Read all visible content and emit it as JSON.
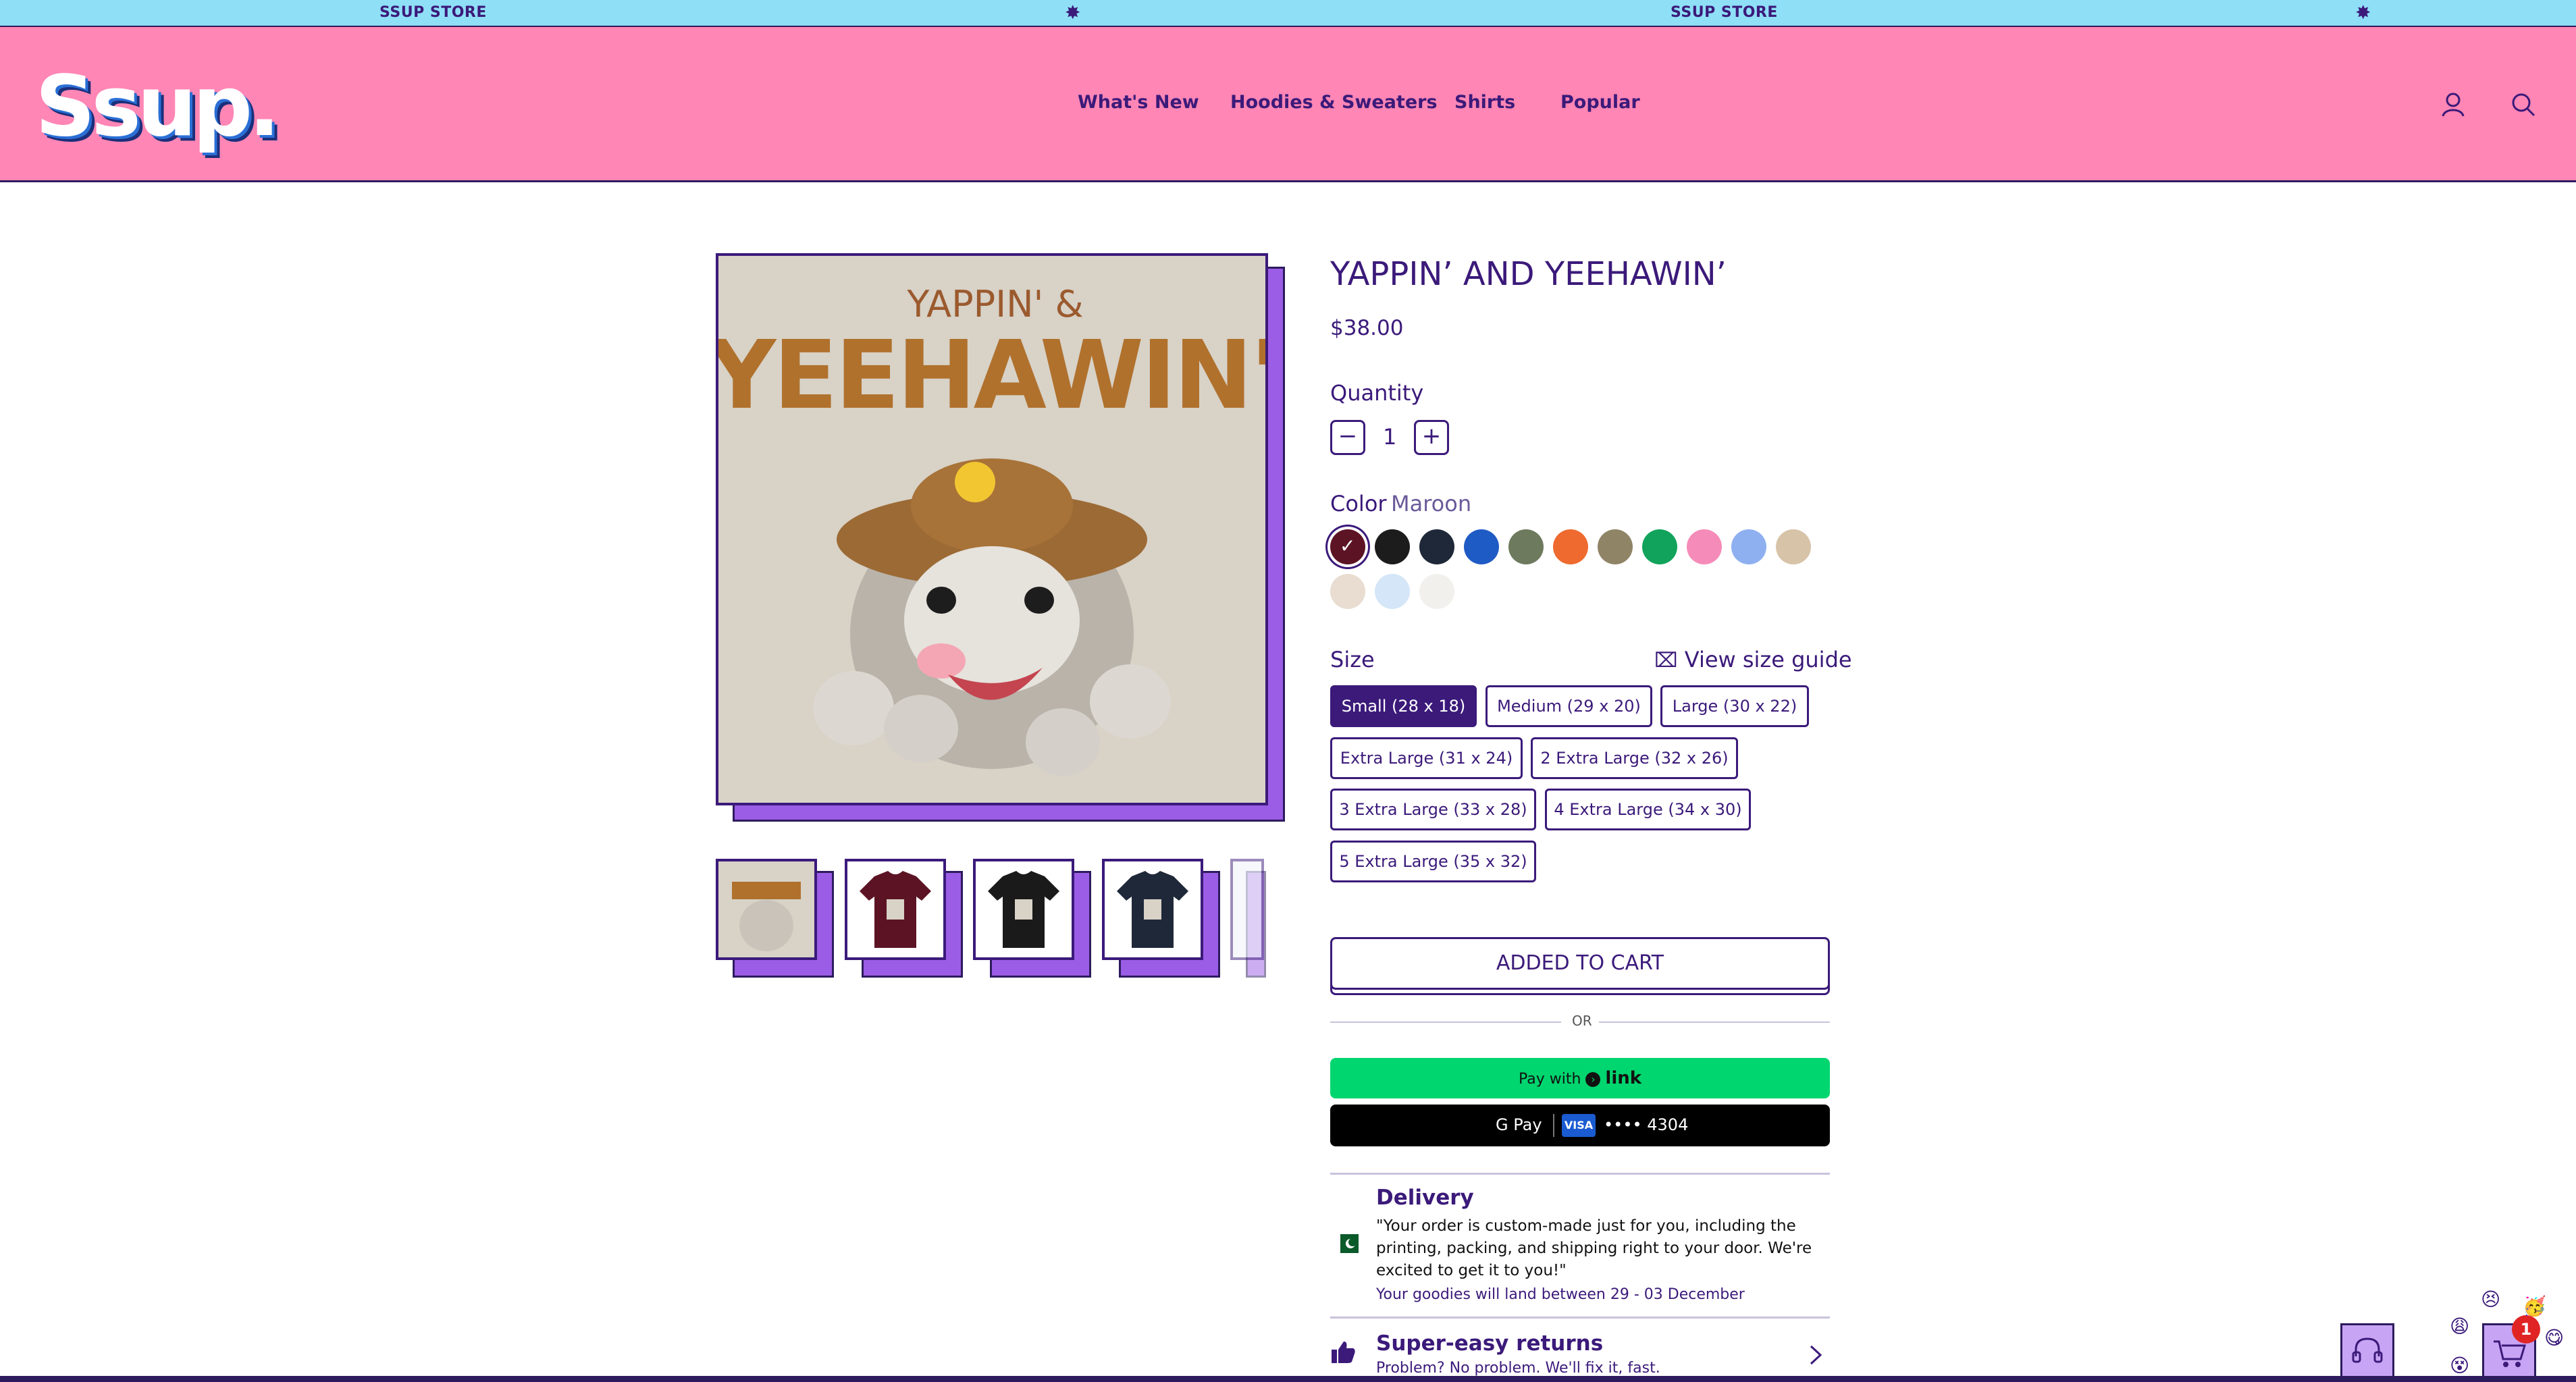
{
  "announcement": {
    "items": [
      "SSUP STORE",
      "SSUP STORE"
    ]
  },
  "header": {
    "logo": "Ssup.",
    "nav": [
      "What's New",
      "Hoodies & Sweaters",
      "Shirts",
      "Popular"
    ]
  },
  "gallery": {
    "art_line1": "YAPPIN' &",
    "art_line2": "YEEHAWIN'",
    "thumbnail_colors": [
      "#d8d2c7",
      "#5c1424",
      "#1a1a1a",
      "#1f2838",
      "#eef2fb"
    ]
  },
  "product": {
    "title": "YAPPIN’ AND YEEHAWIN’",
    "price": "$38.00",
    "quantity_label": "Quantity",
    "quantity_value": "1",
    "color_label": "Color",
    "selected_color": "Maroon",
    "colors": [
      "#5c1424",
      "#1c1c1c",
      "#1f2838",
      "#1f5bc4",
      "#6e7a5e",
      "#ef6a2f",
      "#8f8466",
      "#11a35b",
      "#f58bb8",
      "#8fb0f0",
      "#d7c3a8",
      "#e8ddd0",
      "#d4e6f7",
      "#f2f0ec"
    ],
    "size_label": "Size",
    "size_guide": "View size guide",
    "sizes": [
      "Small (28 x 18)",
      "Medium (29 x 20)",
      "Large (30 x 22)",
      "Extra Large (31 x 24)",
      "2 Extra Large (32 x 26)",
      "3 Extra Large (33 x 28)",
      "4 Extra Large (34 x 30)",
      "5 Extra Large (35 x 32)"
    ],
    "selected_size": "Small (28 x 18)"
  },
  "actions": {
    "cart_button": "ADDED TO CART",
    "or": "OR",
    "pay_with": "Pay with",
    "link": "link",
    "gpay": "G Pay",
    "card_brand": "VISA",
    "card_digits": "•••• 4304"
  },
  "info": {
    "delivery_title": "Delivery",
    "delivery_text": "\"Your order is custom-made just for you, including the printing, packing, and shipping right to your door. We're excited to get it to you!\"",
    "delivery_window": "Your goodies will land between 29 - 03 December",
    "returns_title": "Super-easy returns",
    "returns_sub": "Problem? No problem. We'll fix it, fast."
  },
  "widgets": {
    "cart_count": "1"
  }
}
